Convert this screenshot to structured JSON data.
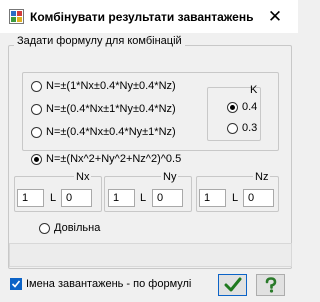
{
  "window": {
    "title": "Комбінувати результати завантажень",
    "close_glyph": "✕"
  },
  "formula_group": {
    "title": "Задати формулу для комбінацій",
    "options": [
      "N=±(1*Nx±0.4*Ny±0.4*Nz)",
      "N=±(0.4*Nx±1*Ny±0.4*Nz)",
      "N=±(0.4*Nx±0.4*Ny±1*Nz)",
      "N=±(Nx^2+Ny^2+Nz^2)^0.5"
    ],
    "selected_option": 3,
    "k": {
      "label": "K",
      "options": [
        "0.4",
        "0.3"
      ],
      "selected": 0
    },
    "ranges": [
      {
        "label": "Nx",
        "from": "1",
        "sep": "L",
        "to": "0"
      },
      {
        "label": "Ny",
        "from": "1",
        "sep": "L",
        "to": "0"
      },
      {
        "label": "Nz",
        "from": "1",
        "sep": "L",
        "to": "0"
      }
    ],
    "custom_label": "Довільна",
    "custom_value": ""
  },
  "footer": {
    "checkbox_label": "Імена завантажень - по формулі",
    "checkbox_checked": true,
    "ok_icon": "checkmark-icon",
    "help_icon": "question-icon",
    "colors": {
      "accent": "#0c63c7",
      "ok_green": "#1f7a1f",
      "help_green": "#2a7a2a"
    }
  }
}
